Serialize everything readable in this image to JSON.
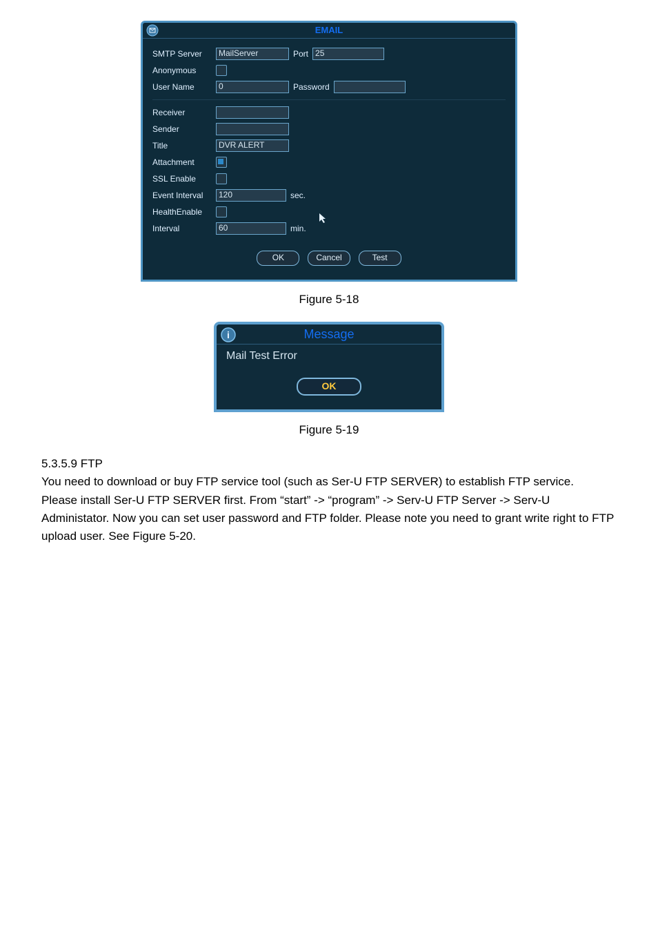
{
  "email_dialog": {
    "title": "EMAIL",
    "fields": {
      "smtp_server_label": "SMTP Server",
      "smtp_server_value": "MailServer",
      "port_label": "Port",
      "port_value": "25",
      "anonymous_label": "Anonymous",
      "user_name_label": "User Name",
      "user_name_value": "0",
      "password_label": "Password",
      "password_value": "",
      "receiver_label": "Receiver",
      "receiver_value": "",
      "sender_label": "Sender",
      "sender_value": "",
      "title_label": "Title",
      "title_value": "DVR ALERT",
      "attachment_label": "Attachment",
      "ssl_enable_label": "SSL Enable",
      "event_interval_label": "Event Interval",
      "event_interval_value": "120",
      "event_interval_unit": "sec.",
      "health_enable_label": "HealthEnable",
      "interval_label": "Interval",
      "interval_value": "60",
      "interval_unit": "min."
    },
    "checkboxes": {
      "anonymous": false,
      "attachment": true,
      "ssl_enable": false,
      "health_enable": false
    },
    "buttons": {
      "ok": "OK",
      "cancel": "Cancel",
      "test": "Test"
    }
  },
  "caption1": "Figure 5-18",
  "message_dialog": {
    "title": "Message",
    "body": "Mail Test Error",
    "button_ok": "OK"
  },
  "caption2": "Figure 5-19",
  "section": {
    "heading": "5.3.5.9  FTP",
    "para1": "You need to download or buy FTP service tool (such as Ser-U FTP SERVER) to establish FTP service.",
    "para2": "Please install Ser-U FTP SERVER first. From “start” -> “program” -> Serv-U FTP Server -> Serv-U Administator. Now you can set user password and FTP folder. Please note you need to grant write right to FTP upload user. See Figure 5-20."
  }
}
